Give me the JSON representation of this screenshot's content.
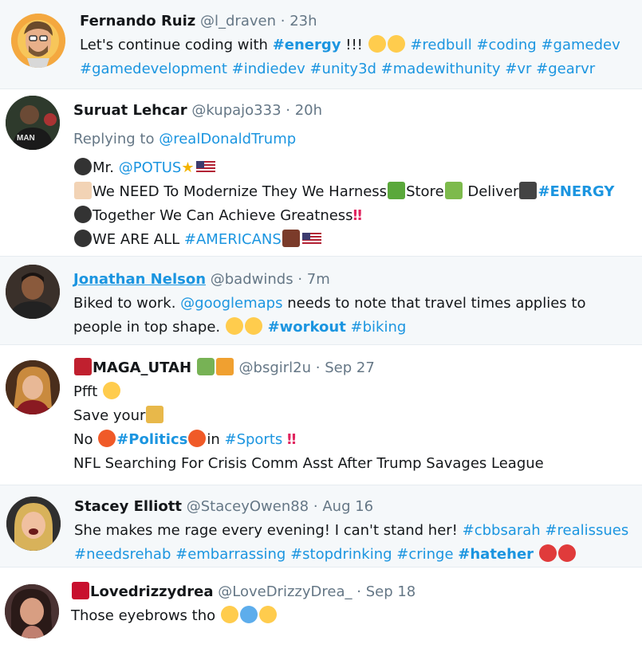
{
  "tweets": [
    {
      "name": "Fernando Ruiz",
      "handle": "@l_draven",
      "dot": "·",
      "time": "23h",
      "body1_pre": "Let's continue coding with ",
      "body1_tag": "#energy",
      "body1_post": " !!! ",
      "tags2": "#redbull #coding #gamedev",
      "line2": "#gamedevelopment #indiedev #unity3d #madewithunity #vr #gearvr",
      "avatar_icon": "cartoon-avatar-icon"
    },
    {
      "name": "Suruat Lehcar",
      "handle": "@kupajo333",
      "dot": "·",
      "time": "20h",
      "reply_prefix": "Replying to ",
      "reply_to": "@realDonaldTrump",
      "l1_pre": "Mr. ",
      "l1_tag": "@POTUS",
      "l2_a": "We NEED To Modernize They We Harness",
      "l2_b": "Store",
      "l2_c": " Deliver",
      "l2_tag": "#ENERGY",
      "l3": "Together We Can Achieve Greatness",
      "l3_mark": "‼",
      "l4_pre": "WE ARE ALL ",
      "l4_tag": "#AMERICANS"
    },
    {
      "name": "Jonathan Nelson",
      "handle": "@badwinds",
      "dot": "·",
      "time": "7m",
      "l1_pre": "Biked to work. ",
      "l1_tag": "@googlemaps",
      "l1_post": " needs to note that travel times applies to",
      "l2_pre": "people in top shape. ",
      "l2_tag1": "#workout",
      "l2_tag2": "#biking"
    },
    {
      "name": "MAGA_UTAH",
      "handle": "@bsgirl2u",
      "dot": "·",
      "time": "Sep 27",
      "l1": "Pfft",
      "l2": "Save your",
      "l3_pre": "No ",
      "l3_tag1": "#Politics",
      "l3_mid": "in ",
      "l3_tag2": "#Sports",
      "l3_mark": "‼",
      "l4": "NFL Searching For Crisis Comm Asst After Trump Savages League"
    },
    {
      "name": "Stacey Elliott",
      "handle": "@StaceyOwen88",
      "dot": "·",
      "time": "Aug 16",
      "l1_pre": "She makes me rage every evening! I can't stand her! ",
      "l1_tags": "#cbbsarah #realissues",
      "l2_tags": "#needsrehab #embarrassing #stopdrinking #cringe",
      "l2_bold": "#hateher"
    },
    {
      "name": "Lovedrizzydrea",
      "handle": "@LoveDrizzyDrea_",
      "dot": "·",
      "time": "Sep 18",
      "l1": "Those eyebrows tho"
    }
  ],
  "colors": {
    "link": "#1b95e0",
    "muted": "#657786",
    "alt_background": "#f5f8fa"
  }
}
